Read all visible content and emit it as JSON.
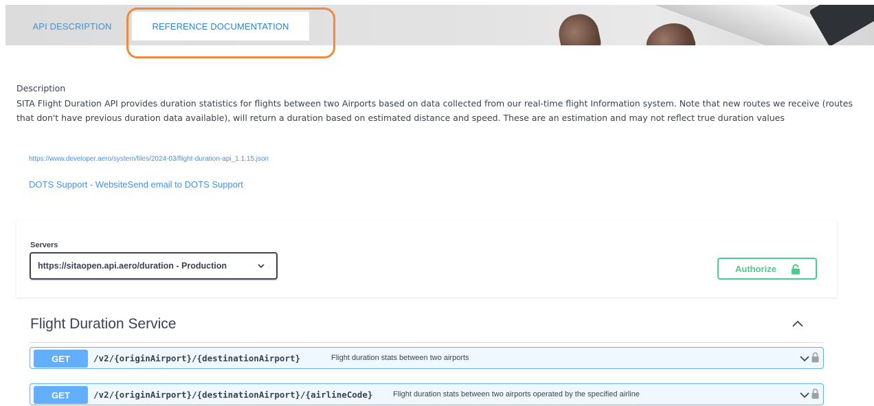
{
  "tabs": {
    "api_description": "API DESCRIPTION",
    "reference_documentation": "REFERENCE DOCUMENTATION"
  },
  "description": {
    "title": "Description",
    "text": "SITA Flight Duration API provides duration statistics for flights between two Airports based on data collected from our real-time flight Information system. Note that new routes we receive (routes that don't have previous duration data available), will return a duration based on estimated distance and speed. These are an estimation and may not reflect true duration values"
  },
  "links": {
    "spec_url": "https://www.developer.aero/system/files/2024-03/flight-duration-api_1.1.15.json",
    "support": "DOTS Support - WebsiteSend email to DOTS Support"
  },
  "servers": {
    "label": "Servers",
    "selected": "https://sitaopen.api.aero/duration - Production"
  },
  "authorize": {
    "label": "Authorize"
  },
  "section": {
    "title": "Flight Duration Service"
  },
  "operations": [
    {
      "method": "GET",
      "path": "/v2/{originAirport}/{destinationAirport}",
      "summary": "Flight duration stats between two airports"
    },
    {
      "method": "GET",
      "path": "/v2/{originAirport}/{destinationAirport}/{airlineCode}",
      "summary": "Flight duration stats between two airports operated by the specified airline"
    }
  ],
  "colors": {
    "get_method": "#61affe",
    "authorize": "#49cc90",
    "link": "#4990e2",
    "highlight": "#f0883e"
  },
  "icons": {
    "server_dropdown": "chevron-down-icon",
    "authorize": "lock-icon",
    "section_toggle": "chevron-up-icon",
    "operation_expand": "chevron-down-icon",
    "operation_auth": "lock-icon"
  }
}
